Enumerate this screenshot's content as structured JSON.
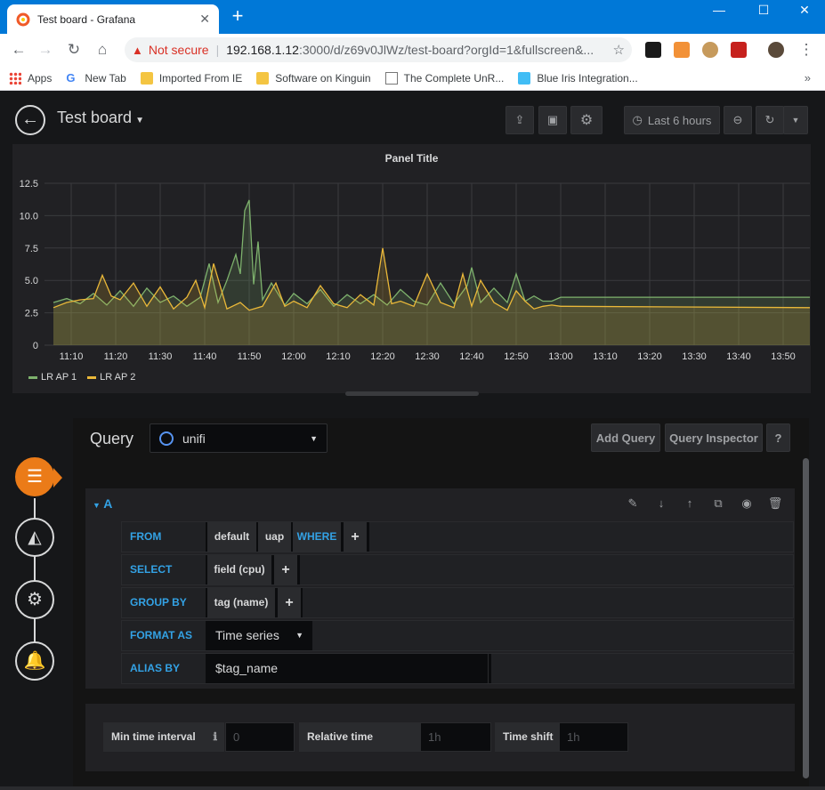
{
  "browser": {
    "tab_title": "Test board - Grafana",
    "not_secure": "Not secure",
    "url_host": "192.168.1.12",
    "url_rest": ":3000/d/z69v0JlWz/test-board?orgId=1&fullscreen&..."
  },
  "bookmarks": [
    {
      "label": "Apps",
      "icon": "apps-grid-icon"
    },
    {
      "label": "New Tab",
      "icon": "google-icon"
    },
    {
      "label": "Imported From IE",
      "icon": "folder-icon"
    },
    {
      "label": "Software on Kinguin",
      "icon": "folder-icon"
    },
    {
      "label": "The Complete UnR...",
      "icon": "page-icon"
    },
    {
      "label": "Blue Iris Integration...",
      "icon": "home-icon"
    }
  ],
  "dashboard": {
    "title": "Test board",
    "time_range": "Last 6 hours"
  },
  "panel": {
    "title": "Panel Title"
  },
  "chart_data": {
    "type": "area",
    "title": "Panel Title",
    "x_ticks": [
      "11:10",
      "11:20",
      "11:30",
      "11:40",
      "11:50",
      "12:00",
      "12:10",
      "12:20",
      "12:30",
      "12:40",
      "12:50",
      "13:00",
      "13:10",
      "13:20",
      "13:30",
      "13:40",
      "13:50"
    ],
    "y_ticks": [
      "0",
      "2.5",
      "5.0",
      "7.5",
      "10.0",
      "12.5"
    ],
    "ylim": [
      0,
      12.5
    ],
    "grid": true,
    "legend_position": "bottom-left",
    "colors": {
      "LR AP 1": "#7eb26d",
      "LR AP 2": "#eab839"
    },
    "series": [
      {
        "name": "LR AP 1",
        "x": [
          "11:06",
          "11:09",
          "11:12",
          "11:15",
          "11:18",
          "11:21",
          "11:24",
          "11:27",
          "11:30",
          "11:33",
          "11:36",
          "11:39",
          "11:41",
          "11:43",
          "11:45",
          "11:47",
          "11:48",
          "11:49",
          "11:50",
          "11:51",
          "11:52",
          "11:53",
          "11:55",
          "11:58",
          "12:00",
          "12:03",
          "12:06",
          "12:09",
          "12:12",
          "12:15",
          "12:18",
          "12:21",
          "12:24",
          "12:27",
          "12:30",
          "12:33",
          "12:36",
          "12:39",
          "12:40",
          "12:42",
          "12:45",
          "12:48",
          "12:50",
          "12:52",
          "12:54",
          "12:56",
          "12:58",
          "13:00",
          "13:30",
          "13:56"
        ],
        "values": [
          3.3,
          3.6,
          3.2,
          4.0,
          3.1,
          4.2,
          3.0,
          4.4,
          3.3,
          3.8,
          3.0,
          3.7,
          6.3,
          3.3,
          5.0,
          7.0,
          5.5,
          10.4,
          11.2,
          4.7,
          8.0,
          3.5,
          4.8,
          3.1,
          4.0,
          3.2,
          4.3,
          3.0,
          3.9,
          3.2,
          3.9,
          3.1,
          4.3,
          3.4,
          3.1,
          4.8,
          3.2,
          4.6,
          6.0,
          3.3,
          4.4,
          3.3,
          5.5,
          3.4,
          3.8,
          3.4,
          3.4,
          3.7,
          3.7,
          3.7
        ]
      },
      {
        "name": "LR AP 2",
        "x": [
          "11:06",
          "11:09",
          "11:12",
          "11:15",
          "11:17",
          "11:19",
          "11:21",
          "11:24",
          "11:27",
          "11:30",
          "11:33",
          "11:36",
          "11:38",
          "11:40",
          "11:42",
          "11:45",
          "11:48",
          "11:50",
          "11:53",
          "11:56",
          "11:58",
          "12:00",
          "12:03",
          "12:06",
          "12:09",
          "12:12",
          "12:15",
          "12:18",
          "12:20",
          "12:22",
          "12:24",
          "12:27",
          "12:30",
          "12:33",
          "12:36",
          "12:38",
          "12:40",
          "12:42",
          "12:45",
          "12:48",
          "12:50",
          "12:52",
          "12:54",
          "12:56",
          "12:58",
          "13:00",
          "13:56"
        ],
        "values": [
          2.9,
          3.3,
          3.5,
          3.6,
          5.4,
          3.8,
          3.5,
          4.8,
          3.0,
          4.5,
          2.8,
          3.7,
          5.0,
          2.9,
          6.3,
          2.8,
          3.3,
          2.7,
          3.0,
          4.8,
          3.0,
          3.4,
          2.9,
          4.6,
          3.2,
          2.9,
          3.9,
          3.1,
          7.5,
          3.2,
          3.4,
          3.0,
          5.5,
          3.3,
          2.9,
          5.5,
          3.0,
          5.0,
          3.3,
          2.7,
          4.2,
          3.4,
          2.8,
          3.0,
          3.1,
          3.0,
          2.9
        ]
      }
    ]
  },
  "query": {
    "label": "Query",
    "datasource": "unifi",
    "add_query": "Add Query",
    "query_inspector": "Query Inspector",
    "help": "?",
    "row_name": "A",
    "rows": {
      "from_key": "FROM",
      "from_policy": "default",
      "from_measurement": "uap",
      "where": "WHERE",
      "select_key": "SELECT",
      "select_field": "field (cpu)",
      "groupby_key": "GROUP BY",
      "groupby_tag": "tag (name)",
      "format_key": "FORMAT AS",
      "format_value": "Time series",
      "alias_key": "ALIAS BY",
      "alias_value": "$tag_name"
    },
    "plus": "+",
    "options": {
      "min_interval_label": "Min time interval",
      "min_interval_placeholder": "0",
      "relative_time_label": "Relative time",
      "relative_time_placeholder": "1h",
      "time_shift_label": "Time shift",
      "time_shift_placeholder": "1h"
    }
  }
}
